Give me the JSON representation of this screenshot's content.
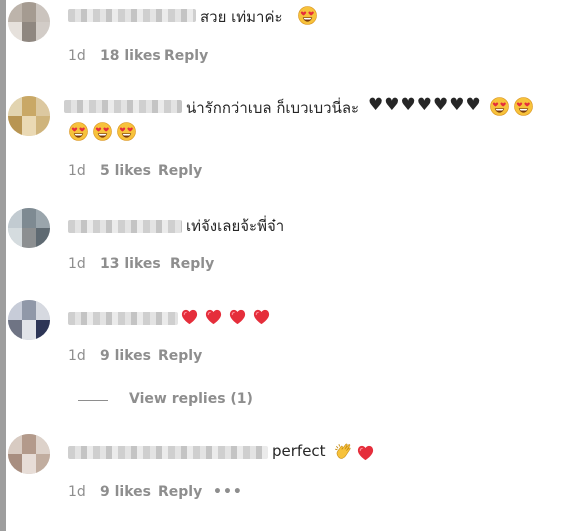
{
  "comments": [
    {
      "text": "สวย เท่มาค่ะ",
      "time": "1d",
      "likes": "18 likes",
      "reply": "Reply"
    },
    {
      "text": "น่ารักกว่าเบล ก็เบวเบวนี่ละ",
      "time": "1d",
      "likes": "5 likes",
      "reply": "Reply"
    },
    {
      "text": "เท่จังเลยจ้ะพี่จ๋า",
      "time": "1d",
      "likes": "13 likes",
      "reply": "Reply"
    },
    {
      "text": "",
      "time": "1d",
      "likes": "9 likes",
      "reply": "Reply",
      "view_replies": "View replies (1)"
    },
    {
      "text": "perfect",
      "time": "1d",
      "likes": "9 likes",
      "reply": "Reply",
      "more": "•••"
    }
  ],
  "icons": {
    "heart_eyes": "smiling-face-with-heart-eyes",
    "black_heart": "black-heart",
    "red_heart": "red-heart",
    "clap": "clapping-hands"
  },
  "colors": {
    "text": "#262626",
    "meta": "#8e8e8e",
    "heart_red": "#e0245e",
    "emoji_yellow": "#f7c23b"
  }
}
